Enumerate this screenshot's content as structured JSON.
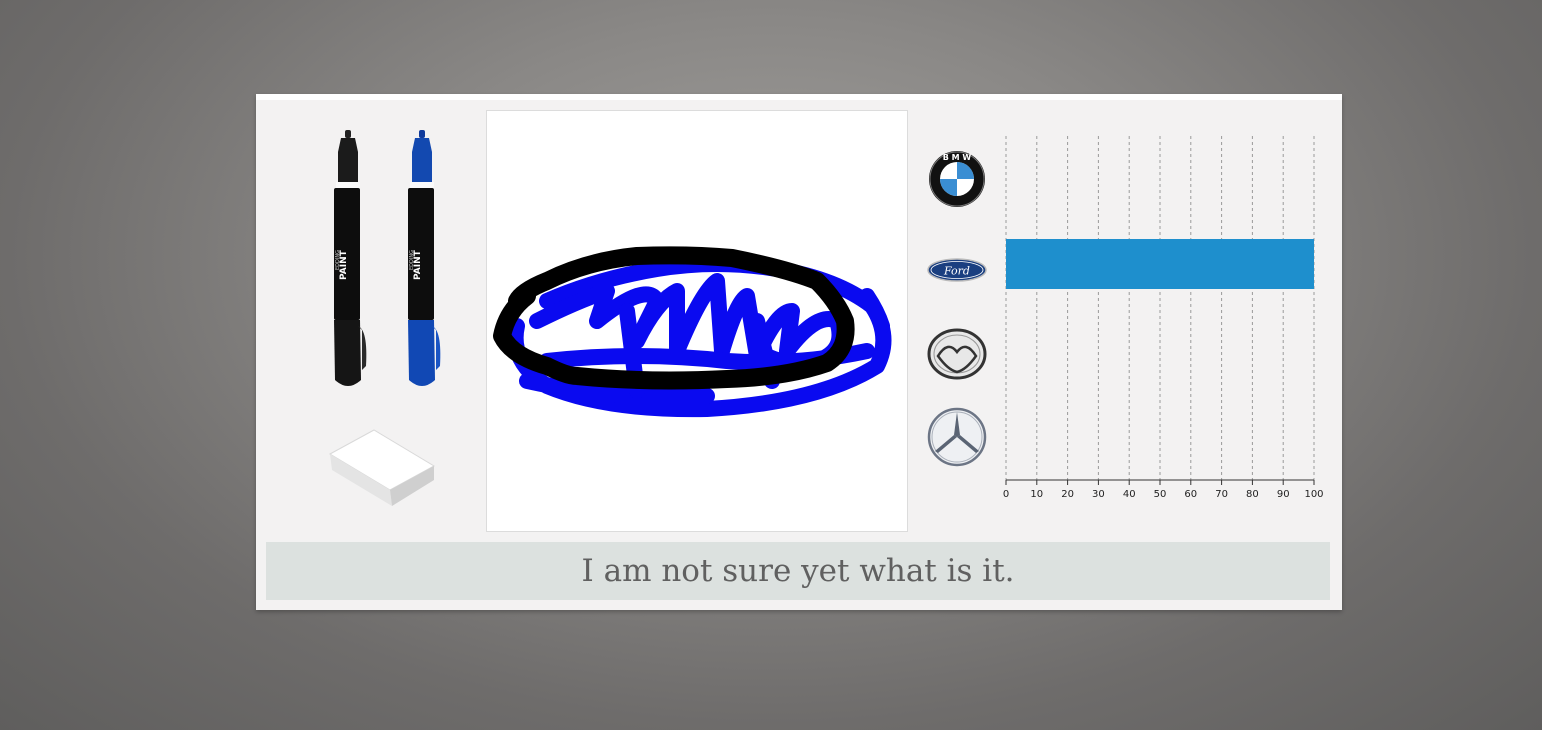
{
  "tools": [
    {
      "name": "black-marker",
      "color": "#111111",
      "brand": "EDDING",
      "label": "PAINT"
    },
    {
      "name": "blue-marker",
      "color": "#1344a8",
      "brand": "EDDING",
      "label": "PAINT"
    },
    {
      "name": "eraser",
      "color": "#f2f2f2"
    }
  ],
  "logos": [
    {
      "name": "bmw-logo-icon",
      "text": "B M W"
    },
    {
      "name": "ford-logo-icon",
      "text": "Ford"
    },
    {
      "name": "mazda-logo-icon"
    },
    {
      "name": "mercedes-logo-icon"
    }
  ],
  "chart_data": {
    "type": "bar",
    "orientation": "horizontal",
    "categories": [
      "BMW",
      "Ford",
      "Mazda",
      "Mercedes"
    ],
    "values": [
      0,
      100,
      0,
      0
    ],
    "xlim": [
      0,
      100
    ],
    "ticks": [
      0,
      10,
      20,
      30,
      40,
      50,
      60,
      70,
      80,
      90,
      100
    ],
    "grid": true,
    "bar_color": "#1e8fcd"
  },
  "status": {
    "message": "I am not sure yet what is it."
  }
}
